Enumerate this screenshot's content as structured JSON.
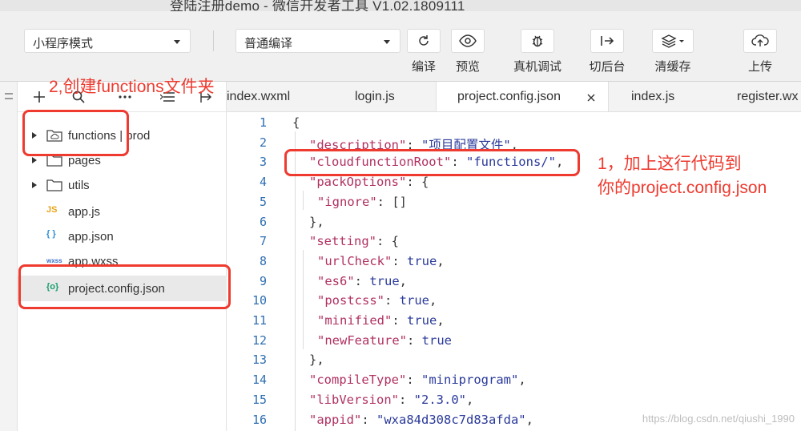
{
  "window": {
    "title": "登陆注册demo - 微信开发者工具 V1.02.1809111"
  },
  "toolbar": {
    "mode_select": "小程序模式",
    "compile_select": "普通编译",
    "buttons": [
      {
        "label": "编译",
        "icon": "refresh-icon"
      },
      {
        "label": "预览",
        "icon": "eye-icon"
      },
      {
        "label": "真机调试",
        "icon": "bug-icon"
      },
      {
        "label": "切后台",
        "icon": "switch-background-icon"
      },
      {
        "label": "清缓存",
        "icon": "layers-icon"
      },
      {
        "label": "上传",
        "icon": "cloud-upload-icon"
      }
    ]
  },
  "explorer": {
    "toolbar_icons": [
      "add-icon",
      "search-icon",
      "more-icon",
      "collapse-icon",
      "split-icon"
    ],
    "tree": [
      {
        "name": "functions",
        "suffix": "| prod",
        "type": "cloud-folder",
        "expandable": true
      },
      {
        "name": "pages",
        "type": "folder",
        "expandable": true
      },
      {
        "name": "utils",
        "type": "folder",
        "expandable": true
      },
      {
        "name": "app.js",
        "type": "js"
      },
      {
        "name": "app.json",
        "type": "json"
      },
      {
        "name": "app.wxss",
        "type": "wxss"
      },
      {
        "name": "project.config.json",
        "type": "config",
        "selected": true
      }
    ]
  },
  "editor": {
    "tabs": [
      "index.wxml",
      "login.js",
      "project.config.json",
      "index.js",
      "register.wx"
    ],
    "active_tab": "project.config.json",
    "line_numbers": [
      "1",
      "2",
      "3",
      "4",
      "5",
      "6",
      "7",
      "8",
      "9",
      "10",
      "11",
      "12",
      "13",
      "14",
      "15",
      "16"
    ],
    "lines": [
      [
        {
          "t": "{",
          "c": "p"
        }
      ],
      [
        {
          "t": "\"description\"",
          "c": "k"
        },
        {
          "t": ": ",
          "c": "p"
        },
        {
          "t": "\"项目配置文件\"",
          "c": "s"
        },
        {
          "t": ",",
          "c": "p"
        }
      ],
      [
        {
          "t": "\"cloudfunctionRoot\"",
          "c": "k"
        },
        {
          "t": ": ",
          "c": "p"
        },
        {
          "t": "\"functions/\"",
          "c": "s"
        },
        {
          "t": ",",
          "c": "p"
        }
      ],
      [
        {
          "t": "\"packOptions\"",
          "c": "k"
        },
        {
          "t": ": {",
          "c": "p"
        }
      ],
      [
        {
          "t": "\"ignore\"",
          "c": "k"
        },
        {
          "t": ": []",
          "c": "p"
        }
      ],
      [
        {
          "t": "},",
          "c": "p"
        }
      ],
      [
        {
          "t": "\"setting\"",
          "c": "k"
        },
        {
          "t": ": {",
          "c": "p"
        }
      ],
      [
        {
          "t": "\"urlCheck\"",
          "c": "k"
        },
        {
          "t": ": ",
          "c": "p"
        },
        {
          "t": "true",
          "c": "v"
        },
        {
          "t": ",",
          "c": "p"
        }
      ],
      [
        {
          "t": "\"es6\"",
          "c": "k"
        },
        {
          "t": ": ",
          "c": "p"
        },
        {
          "t": "true",
          "c": "v"
        },
        {
          "t": ",",
          "c": "p"
        }
      ],
      [
        {
          "t": "\"postcss\"",
          "c": "k"
        },
        {
          "t": ": ",
          "c": "p"
        },
        {
          "t": "true",
          "c": "v"
        },
        {
          "t": ",",
          "c": "p"
        }
      ],
      [
        {
          "t": "\"minified\"",
          "c": "k"
        },
        {
          "t": ": ",
          "c": "p"
        },
        {
          "t": "true",
          "c": "v"
        },
        {
          "t": ",",
          "c": "p"
        }
      ],
      [
        {
          "t": "\"newFeature\"",
          "c": "k"
        },
        {
          "t": ": ",
          "c": "p"
        },
        {
          "t": "true",
          "c": "v"
        }
      ],
      [
        {
          "t": "},",
          "c": "p"
        }
      ],
      [
        {
          "t": "\"compileType\"",
          "c": "k"
        },
        {
          "t": ": ",
          "c": "p"
        },
        {
          "t": "\"miniprogram\"",
          "c": "s"
        },
        {
          "t": ",",
          "c": "p"
        }
      ],
      [
        {
          "t": "\"libVersion\"",
          "c": "k"
        },
        {
          "t": ": ",
          "c": "p"
        },
        {
          "t": "\"2.3.0\"",
          "c": "s"
        },
        {
          "t": ",",
          "c": "p"
        }
      ],
      [
        {
          "t": "\"appid\"",
          "c": "k"
        },
        {
          "t": ": ",
          "c": "p"
        },
        {
          "t": "\"wxa84d308c7d83afda\"",
          "c": "s"
        },
        {
          "t": ",",
          "c": "p"
        }
      ]
    ]
  },
  "annotations": {
    "step1_line1": "1，加上这行代码到",
    "step1_line2": "你的project.config.json",
    "step2": "2,创建functions文件夹",
    "color": "#ee3a2f"
  },
  "watermark": "https://blog.csdn.net/qiushi_1990"
}
